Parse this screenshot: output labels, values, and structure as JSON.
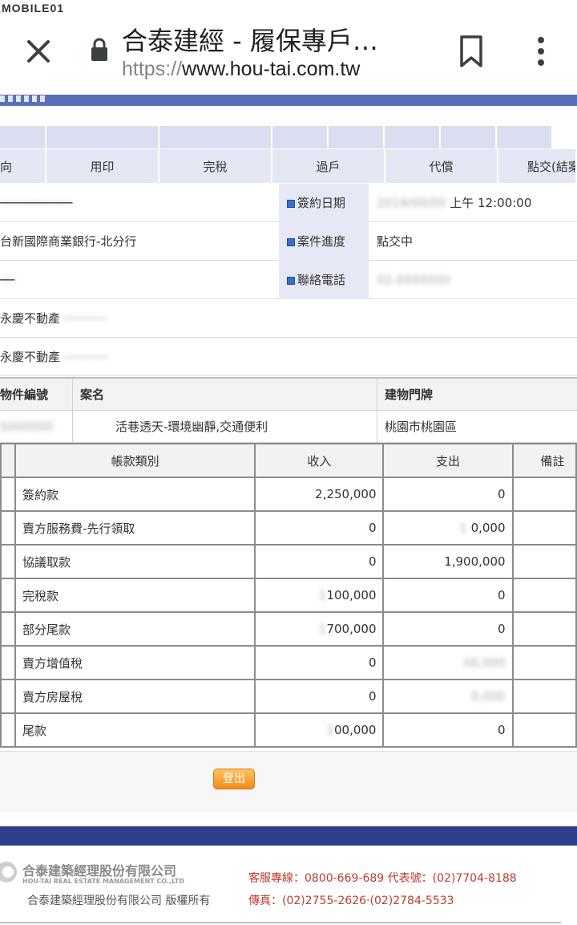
{
  "watermark": "MOBILE01",
  "browser": {
    "title": "合泰建經 - 履保專戶…",
    "url_scheme": "https://",
    "url_host": "www.hou-tai.com.tw"
  },
  "tabs": [
    "向",
    "用印",
    "完稅",
    "過戶",
    "代償",
    "點交(結案)"
  ],
  "info": {
    "rows": [
      {
        "left": "",
        "key": "簽約日期",
        "value": "上午 12:00:00"
      },
      {
        "left": "台新國際商業銀行-北分行",
        "key": "案件進度",
        "value": "點交中"
      },
      {
        "left": "",
        "key": "聯絡電話",
        "value": ""
      },
      {
        "left": "永慶不動產",
        "key": "",
        "value": ""
      },
      {
        "left": "永慶不動產",
        "key": "",
        "value": ""
      }
    ]
  },
  "property": {
    "headers": [
      "物件編號",
      "案名",
      "建物門牌"
    ],
    "values": [
      "",
      "活巷透天-環境幽靜,交通便利",
      "桃園市桃園區"
    ]
  },
  "ledger": {
    "headers": [
      "帳款類別",
      "收入",
      "支出",
      "備註"
    ],
    "rows": [
      {
        "category": "簽約款",
        "income": "2,250,000",
        "expense": "0"
      },
      {
        "category": "賣方服務費-先行領取",
        "income": "0",
        "expense": "0,000"
      },
      {
        "category": "協議取款",
        "income": "0",
        "expense": "1,900,000"
      },
      {
        "category": "完稅款",
        "income": "100,000",
        "expense": "0"
      },
      {
        "category": "部分尾款",
        "income": "700,000",
        "expense": "0"
      },
      {
        "category": "賣方增值稅",
        "income": "0",
        "expense": ""
      },
      {
        "category": "賣方房屋稅",
        "income": "0",
        "expense": ""
      },
      {
        "category": "尾款",
        "income": "00,000",
        "expense": "0"
      }
    ]
  },
  "logout_label": "登出",
  "footer": {
    "company": "合泰建築經理股份有限公司",
    "company_en": "HOU-TAI REAL ESTATE MANAGEMENT CO.,LTD",
    "copyright": "合泰建築經理股份有限公司 版權所有",
    "service_line": "客服專線：0800-669-689  代表號：(02)7704-8188",
    "fax_line": "傳真：(02)2755-2626·(02)2784-5533"
  },
  "colors": {
    "header_band": "#5b6fb8",
    "footer_band": "#2f3f8c",
    "tab_bg": "#e4e8f5",
    "key_bg": "#e6e9f5",
    "logout": "#f08a1c",
    "contact_red": "#c0392b"
  }
}
